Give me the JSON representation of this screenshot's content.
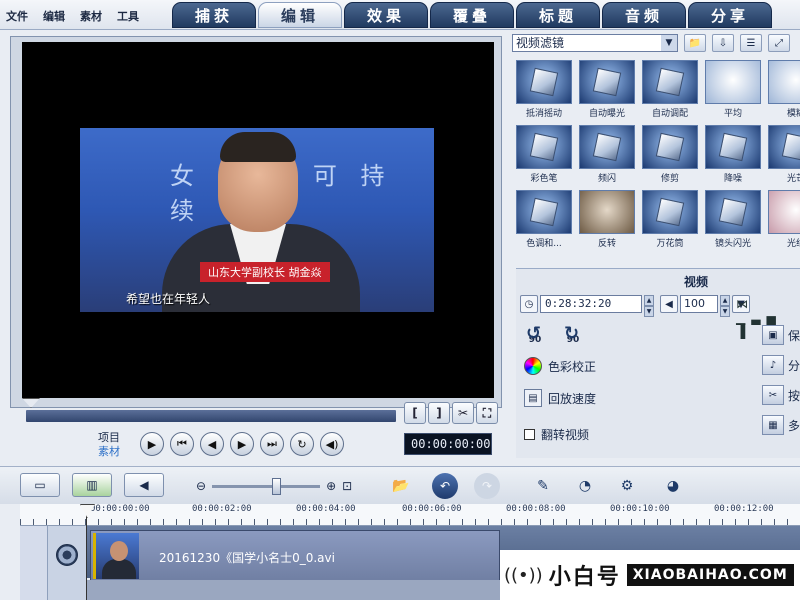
{
  "menu": [
    "文件",
    "编辑",
    "素材",
    "工具"
  ],
  "tabs": [
    {
      "label": "捕获",
      "active": false
    },
    {
      "label": "编辑",
      "active": true
    },
    {
      "label": "效果",
      "active": false
    },
    {
      "label": "覆叠",
      "active": false
    },
    {
      "label": "标题",
      "active": false
    },
    {
      "label": "音频",
      "active": false
    },
    {
      "label": "分享",
      "active": false
    }
  ],
  "preview": {
    "banner_text": "女 性    类 可 持 续",
    "caption": "山东大学副校长 胡金焱",
    "subtitle": "希望也在年轻人"
  },
  "playback": {
    "mode_project": "项目",
    "mode_clip": "素材",
    "timecode": "00:00:00:00",
    "mark_in": "[",
    "mark_out": "]"
  },
  "library": {
    "category": "视频滤镜",
    "filters": [
      {
        "label": "抵消摇动",
        "style": "cube"
      },
      {
        "label": "自动曝光",
        "style": "cube"
      },
      {
        "label": "自动调配",
        "style": "cube"
      },
      {
        "label": "平均",
        "style": "light"
      },
      {
        "label": "模糊",
        "style": "light"
      },
      {
        "label": "彩色笔",
        "style": "cube"
      },
      {
        "label": "频闪",
        "style": "cube"
      },
      {
        "label": "修剪",
        "style": "cube"
      },
      {
        "label": "降噪",
        "style": "cube"
      },
      {
        "label": "光芒",
        "style": "cube"
      },
      {
        "label": "色调和...",
        "style": "cube"
      },
      {
        "label": "反转",
        "style": "warm"
      },
      {
        "label": "万花筒",
        "style": "cube"
      },
      {
        "label": "镜头闪光",
        "style": "cube"
      },
      {
        "label": "光线",
        "style": "pink"
      }
    ]
  },
  "options": {
    "title": "视频",
    "duration": "0:28:32:20",
    "volume": "100",
    "rotate_ccw": "90",
    "rotate_cw": "90",
    "color_correction": "色彩校正",
    "playback_speed": "回放速度",
    "flip_video": "翻转视频",
    "side_buttons": [
      "保",
      "分",
      "按",
      "多"
    ]
  },
  "timeline": {
    "ticks": [
      "00:00:00:00",
      "00:00:02:00",
      "00:00:04:00",
      "00:00:06:00",
      "00:00:08:00",
      "00:00:10:00",
      "00:00:12:00"
    ],
    "clip_name": "20161230《国学小名士0_0.avi"
  },
  "watermark": {
    "cn": "小白号",
    "en": "XIAOBAIHAO.COM"
  }
}
